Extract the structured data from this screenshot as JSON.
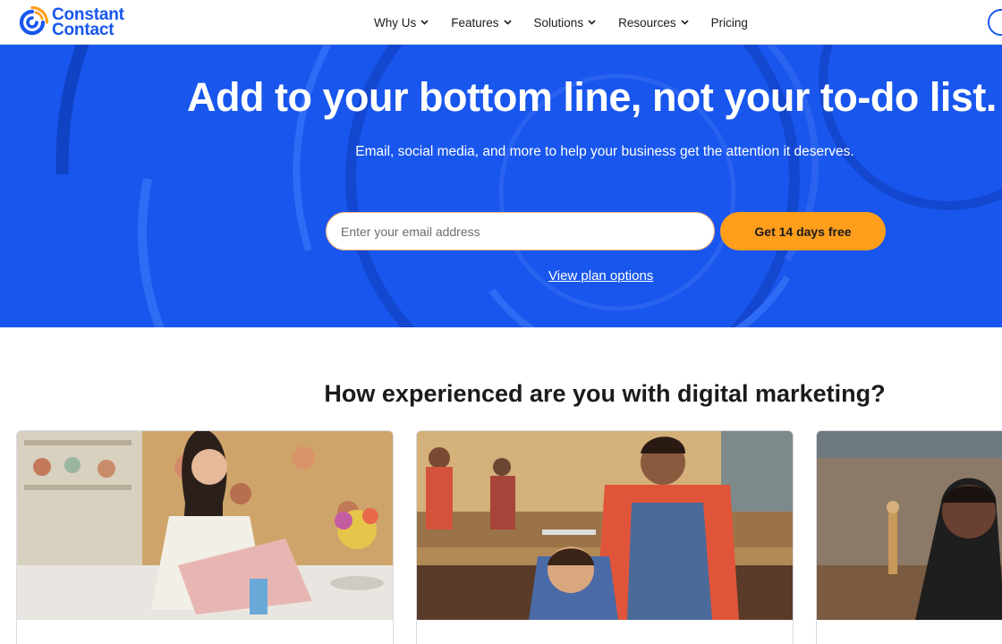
{
  "brand": {
    "line1": "Constant",
    "line2": "Contact",
    "primary_color": "#1856ed",
    "accent_color": "#ff9e1b"
  },
  "nav": {
    "items": [
      {
        "label": "Why Us",
        "has_dropdown": true
      },
      {
        "label": "Features",
        "has_dropdown": true
      },
      {
        "label": "Solutions",
        "has_dropdown": true
      },
      {
        "label": "Resources",
        "has_dropdown": true
      },
      {
        "label": "Pricing",
        "has_dropdown": false
      }
    ]
  },
  "hero": {
    "title": "Add to your bottom line, not your to-do list.",
    "subtitle": "Email, social media, and more to help your business get the attention it deserves.",
    "email_placeholder": "Enter your email address",
    "cta_label": "Get 14 days free",
    "plan_link": "View plan options"
  },
  "experience": {
    "title": "How experienced are you with digital marketing?",
    "cards": [
      {
        "image": "woman-at-laptop-photo"
      },
      {
        "image": "barber-cutting-hair-photo"
      },
      {
        "image": "woman-in-cafe-photo"
      }
    ]
  }
}
